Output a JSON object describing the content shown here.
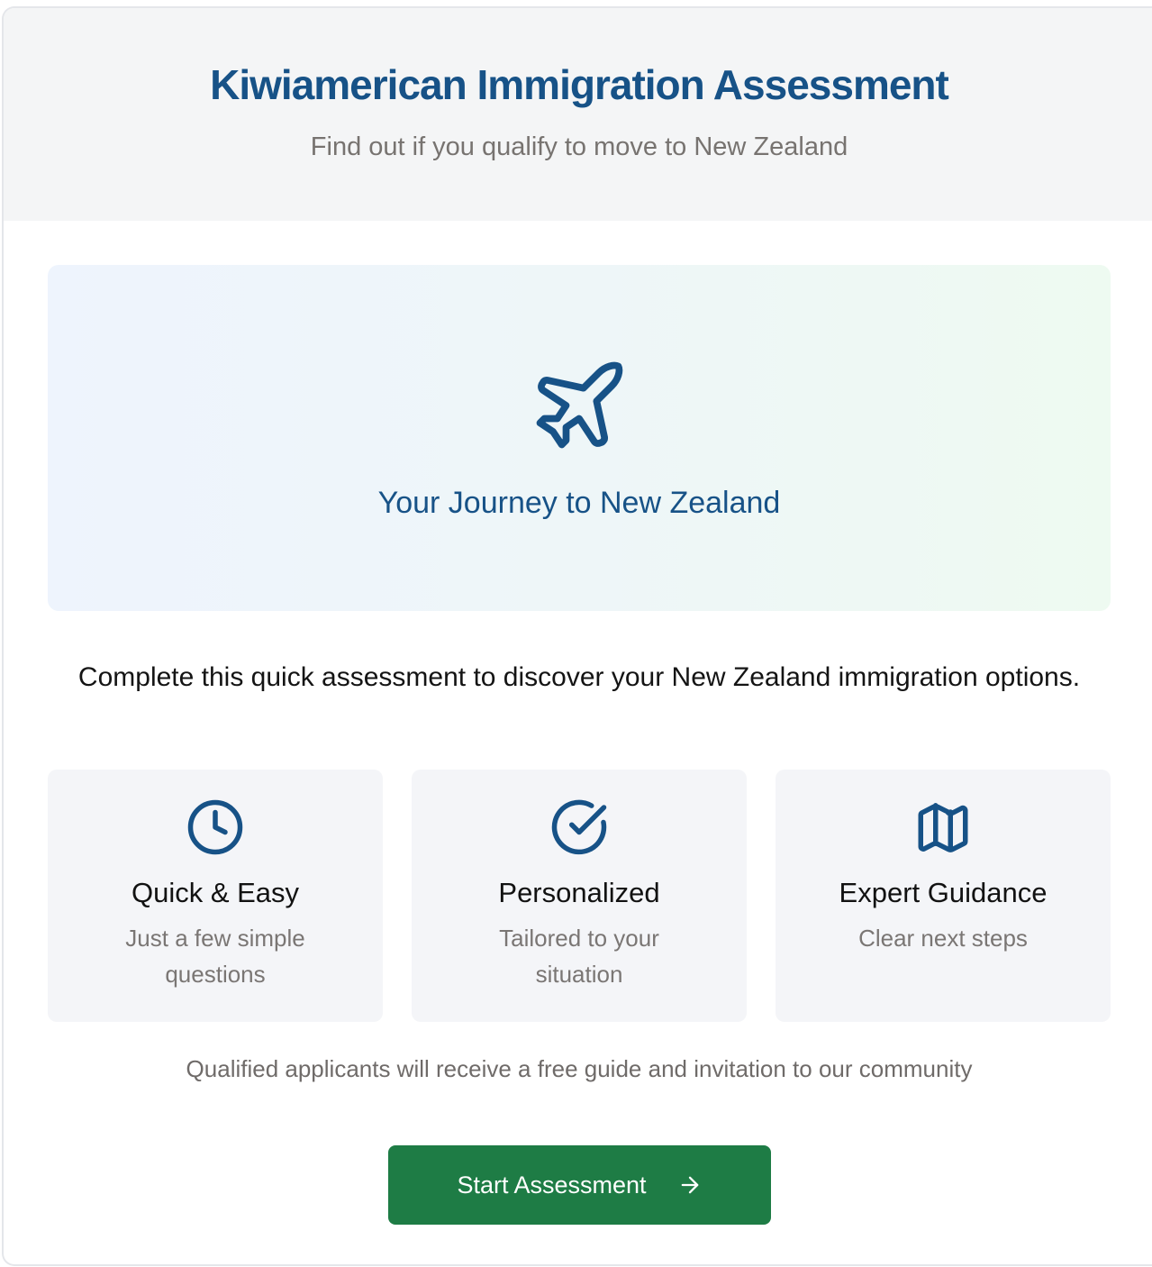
{
  "header": {
    "title": "Kiwiamerican Immigration Assessment",
    "subtitle": "Find out if you qualify to move to New Zealand"
  },
  "hero": {
    "icon": "plane-icon",
    "title": "Your Journey to New Zealand"
  },
  "intro": "Complete this quick assessment to discover your New Zealand immigration options.",
  "features": [
    {
      "icon": "clock-icon",
      "title": "Quick & Easy",
      "description": "Just a few simple questions"
    },
    {
      "icon": "check-circle-icon",
      "title": "Personalized",
      "description": "Tailored to your situation"
    },
    {
      "icon": "map-icon",
      "title": "Expert Guidance",
      "description": "Clear next steps"
    }
  ],
  "note": "Qualified applicants will receive a free guide and invitation to our community",
  "cta": {
    "label": "Start Assessment",
    "icon": "arrow-right-icon"
  },
  "colors": {
    "primary_blue": "#175287",
    "button_green": "#1e7c45",
    "muted_text": "#777370"
  }
}
